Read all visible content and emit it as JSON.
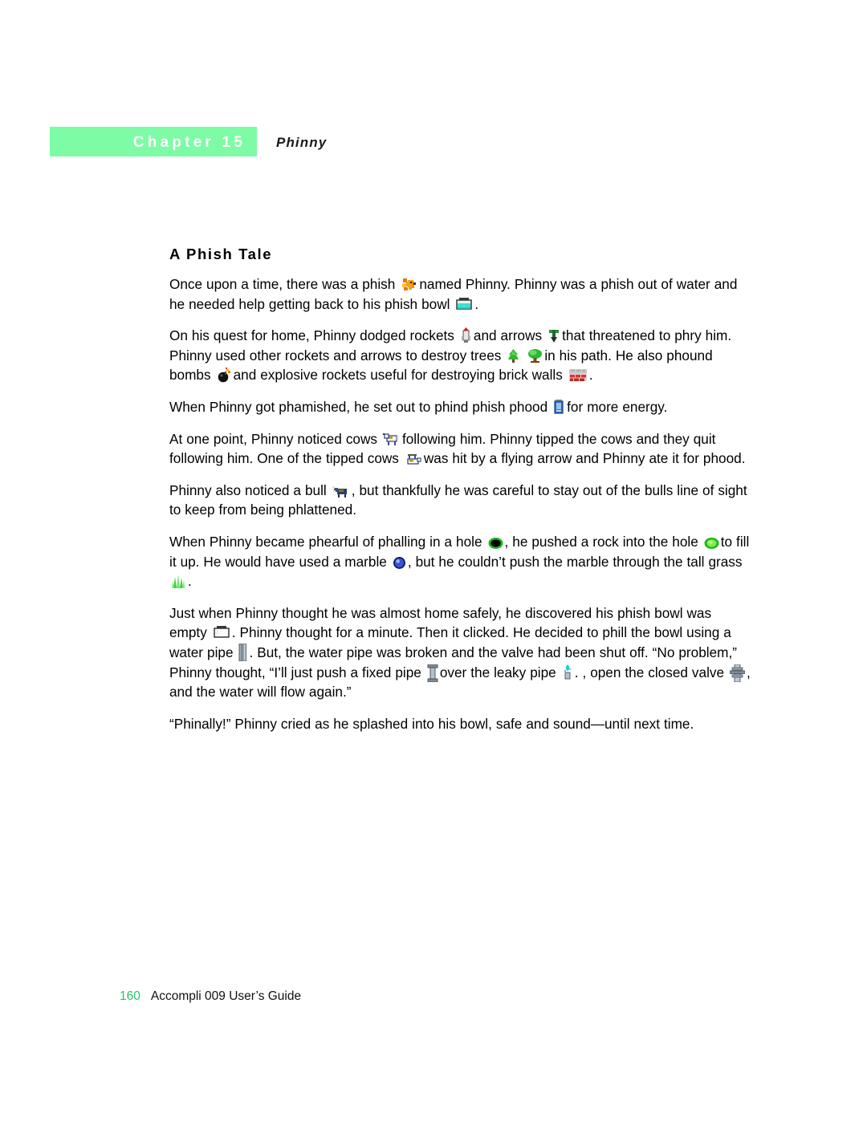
{
  "page": {
    "chapter_label": "Chapter 15",
    "running_head": "Phinny",
    "section_title": "A Phish Tale",
    "accent_green": "#7dfca5",
    "page_number_color": "#24c46b"
  },
  "paragraphs": {
    "p1_a": "Once upon a time, there was a phish",
    "p1_b": "named Phinny. Phinny was a phish out of water and he needed help getting back to his phish bowl",
    "p1_c": ".",
    "p2_a": "On his quest for home, Phinny dodged rockets",
    "p2_b": "and arrows",
    "p2_c": "that threatened to phry him. Phinny used other rockets and arrows to destroy trees",
    "p2_d": "in his path. He also phound bombs",
    "p2_e": "and explosive rockets useful for destroying brick walls",
    "p2_f": ".",
    "p3_a": "When Phinny got phamished, he set out to phind phish phood",
    "p3_b": "for more energy.",
    "p4_a": "At one point, Phinny noticed cows",
    "p4_b": "following him. Phinny tipped the cows and they quit following him. One of the tipped cows",
    "p4_c": "was hit by a flying arrow and Phinny ate it for phood.",
    "p5_a": "Phinny also noticed a bull",
    "p5_b": ", but thankfully he was careful to stay out of the bulls line of sight to keep from being phlattened.",
    "p6_a": "When Phinny became phearful of phalling in a hole",
    "p6_b": ", he pushed a rock into the hole",
    "p6_c": "to fill it up. He would have used a marble",
    "p6_d": ", but he couldn’t push the marble through the tall grass",
    "p6_e": ".",
    "p7_a": "Just when Phinny thought he was almost home safely, he discovered his phish bowl was empty",
    "p7_b": ". Phinny thought for a minute. Then it clicked. He decided to phill the bowl using a water pipe",
    "p7_c": ". But, the water pipe was broken and the valve had been shut off. “No problem,” Phinny thought, “I’ll just push a fixed pipe",
    "p7_d": "over the leaky pipe",
    "p7_e": ". , open the closed valve",
    "p7_f": ", and the water will flow again.”",
    "p8": "“Phinally!” Phinny cried as he splashed into his bowl, safe and sound—until next time."
  },
  "icons": {
    "fish": "phish-fish-icon",
    "bowl_full": "phish-bowl-full-icon",
    "rocket": "rocket-icon",
    "arrow": "arrow-icon",
    "tree_bush": "tree-bush-icon",
    "tree_trunk": "tree-trunk-icon",
    "bomb": "bomb-icon",
    "brick_wall": "brick-wall-icon",
    "phish_phood": "phish-phood-icon",
    "cow": "cow-icon",
    "tipped_cow": "tipped-cow-icon",
    "bull": "bull-icon",
    "hole": "hole-icon",
    "rock": "rock-icon",
    "marble": "marble-icon",
    "grass": "tall-grass-icon",
    "bowl_empty": "phish-bowl-empty-icon",
    "water_pipe": "water-pipe-icon",
    "fixed_pipe": "fixed-pipe-icon",
    "leaky_pipe": "leaky-pipe-icon",
    "valve": "valve-icon"
  },
  "footer": {
    "page_number": "160",
    "document_name": "Accompli 009 User’s Guide"
  }
}
